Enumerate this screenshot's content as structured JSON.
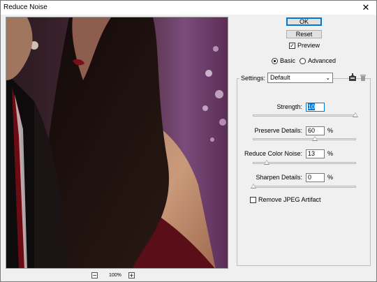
{
  "window": {
    "title": "Reduce Noise",
    "close_glyph": "✕"
  },
  "zoom": {
    "out_glyph": "−",
    "in_glyph": "+",
    "level": "100%"
  },
  "buttons": {
    "ok": "OK",
    "reset": "Reset"
  },
  "preview": {
    "label": "Preview",
    "checked": true
  },
  "mode": {
    "basic": "Basic",
    "advanced": "Advanced",
    "selected": "Basic"
  },
  "settings": {
    "label": "Settings:",
    "value": "Default",
    "save_icon": "save-settings-icon",
    "delete_icon": "trash-icon"
  },
  "params": {
    "strength": {
      "label": "Strength:",
      "value": "10",
      "unit": "",
      "fraction": 1.0
    },
    "preserve_details": {
      "label": "Preserve Details:",
      "value": "60",
      "unit": "%",
      "fraction": 0.6
    },
    "reduce_color_noise": {
      "label": "Reduce Color Noise:",
      "value": "13",
      "unit": "%",
      "fraction": 0.13
    },
    "sharpen_details": {
      "label": "Sharpen Details:",
      "value": "0",
      "unit": "%",
      "fraction": 0.0
    }
  },
  "jpeg": {
    "label": "Remove JPEG Artifact",
    "checked": false
  },
  "colors": {
    "accent": "#0078d7"
  }
}
